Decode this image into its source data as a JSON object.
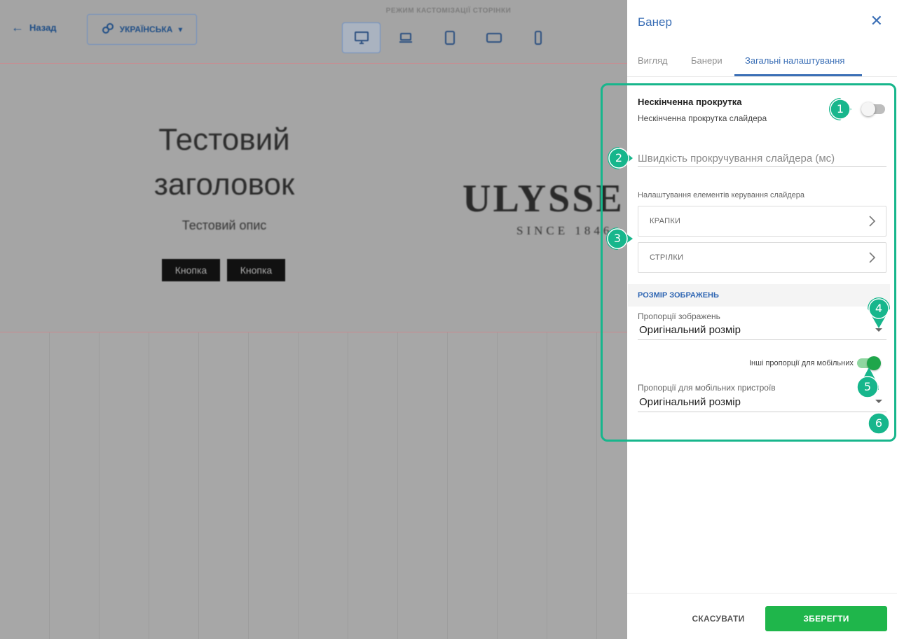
{
  "editor": {
    "back_label": "Назад",
    "language_label": "УКРАЇНСЬКА",
    "mode_label": "РЕЖИМ КАСТОМІЗАЦІЇ СТОРІНКИ",
    "devices": [
      "desktop-icon",
      "laptop-icon",
      "tablet-icon",
      "tablet-landscape-icon",
      "mobile-icon"
    ],
    "active_device": "desktop-icon"
  },
  "banner_preview": {
    "title_line1": "Тестовий",
    "title_line2": "заголовок",
    "description": "Тестовий опис",
    "buttons": [
      "Кнопка",
      "Кнопка"
    ],
    "logo_text": "ULYSSE",
    "logo_sub": "SINCE 1846"
  },
  "panel": {
    "title": "Банер",
    "tabs": [
      {
        "label": "Вигляд",
        "active": false
      },
      {
        "label": "Банери",
        "active": false
      },
      {
        "label": "Загальні налаштування",
        "active": true
      }
    ],
    "infinite_scroll": {
      "label": "Нескінченна прокрутка",
      "sublabel": "Нескінченна прокрутка слайдера",
      "enabled": false
    },
    "speed_input": {
      "placeholder": "Швидкість прокручування слайдера (мс)",
      "value": ""
    },
    "controls_label": "Налаштування елементів керування слайдера",
    "accordions": [
      {
        "label": "КРАПКИ"
      },
      {
        "label": "СТРІЛКИ"
      }
    ],
    "image_size_section": "РОЗМІР ЗОБРАЖЕНЬ",
    "aspect_select": {
      "label": "Пропорції зображень",
      "value": "Оригінальний розмір"
    },
    "mobile_toggle": {
      "label": "Інші пропорції для мобільних",
      "enabled": true
    },
    "mobile_select": {
      "label": "Пропорції для мобільних пристроїв",
      "value": "Оригінальний розмір"
    },
    "cancel_label": "СКАСУВАТИ",
    "save_label": "ЗБЕРЕГТИ"
  },
  "annotations": [
    "1",
    "2",
    "3",
    "4",
    "5",
    "6"
  ],
  "colors": {
    "accent": "#3b6fb6",
    "highlight": "#17b68c",
    "save": "#1fb64b"
  }
}
